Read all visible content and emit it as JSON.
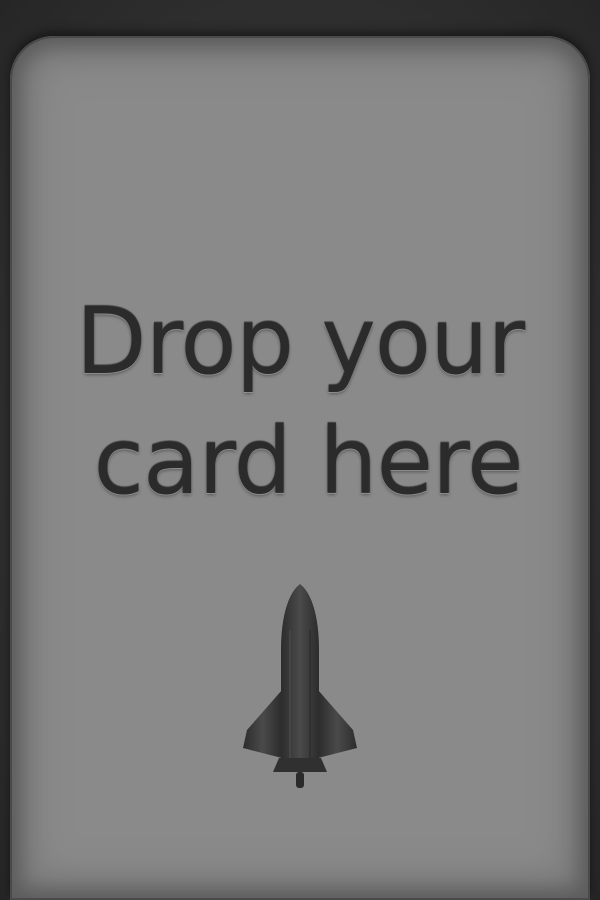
{
  "drop_zone": {
    "line1": "Drop your",
    "line2": "card here",
    "icon": "space-shuttle-icon"
  },
  "colors": {
    "background": "#2f2f2f",
    "zone_fill": "#8a8a8a",
    "text": "#2b2b2b",
    "icon": "#3a3a3a"
  }
}
